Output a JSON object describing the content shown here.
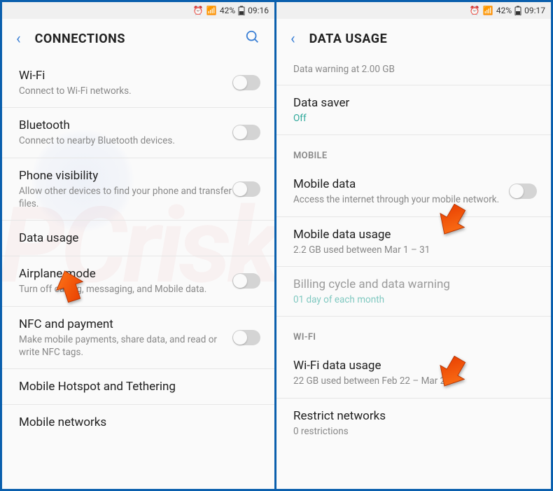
{
  "left": {
    "status": {
      "battery": "42%",
      "time": "09:16"
    },
    "header": {
      "title": "CONNECTIONS"
    },
    "items": {
      "wifi": {
        "title": "Wi-Fi",
        "sub": "Connect to Wi-Fi networks."
      },
      "bluetooth": {
        "title": "Bluetooth",
        "sub": "Connect to nearby Bluetooth devices."
      },
      "visibility": {
        "title": "Phone visibility",
        "sub": "Allow other devices to find your phone and transfer files."
      },
      "data_usage": {
        "title": "Data usage"
      },
      "airplane": {
        "title": "Airplane mode",
        "sub": "Turn off calling, messaging, and Mobile data."
      },
      "nfc": {
        "title": "NFC and payment",
        "sub": "Make mobile payments, share data, and read or write NFC tags."
      },
      "hotspot": {
        "title": "Mobile Hotspot and Tethering"
      },
      "networks": {
        "title": "Mobile networks"
      }
    }
  },
  "right": {
    "status": {
      "battery": "42%",
      "time": "09:17"
    },
    "header": {
      "title": "DATA USAGE"
    },
    "top_note": "Data warning at 2.00 GB",
    "items": {
      "data_saver": {
        "title": "Data saver",
        "sub": "Off"
      },
      "mobile_section": "MOBILE",
      "mobile_data": {
        "title": "Mobile data",
        "sub": "Access the internet through your mobile network."
      },
      "mobile_usage": {
        "title": "Mobile data usage",
        "sub": "2.2 GB used between Mar 1 – 31"
      },
      "billing": {
        "title": "Billing cycle and data warning",
        "sub": "01 day of each month"
      },
      "wifi_section": "WI-FI",
      "wifi_usage": {
        "title": "Wi-Fi data usage",
        "sub": "22 GB used between Feb 22 – Mar 21"
      },
      "restrict": {
        "title": "Restrict networks",
        "sub": "0 restrictions"
      }
    }
  }
}
